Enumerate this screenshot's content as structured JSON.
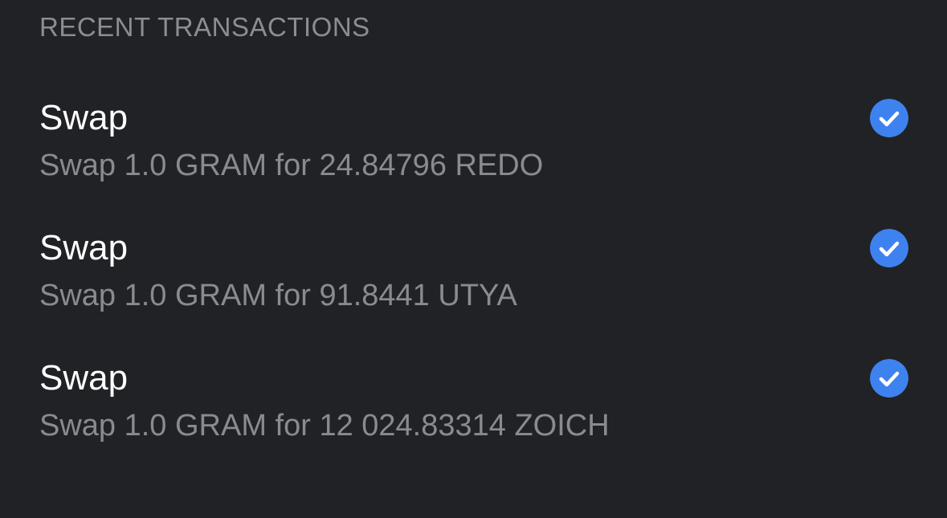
{
  "section": {
    "title": "RECENT TRANSACTIONS"
  },
  "colors": {
    "background": "#212226",
    "title_text": "#ffffff",
    "secondary_text": "#8a8b90",
    "status_accent": "#3e82f0"
  },
  "transactions": [
    {
      "title": "Swap",
      "description": "Swap 1.0 GRAM for 24.84796 REDO",
      "status_icon": "check-circle-icon"
    },
    {
      "title": "Swap",
      "description": "Swap 1.0 GRAM for 91.8441 UTYA",
      "status_icon": "check-circle-icon"
    },
    {
      "title": "Swap",
      "description": "Swap 1.0 GRAM for 12 024.83314 ZOICH",
      "status_icon": "check-circle-icon"
    }
  ]
}
